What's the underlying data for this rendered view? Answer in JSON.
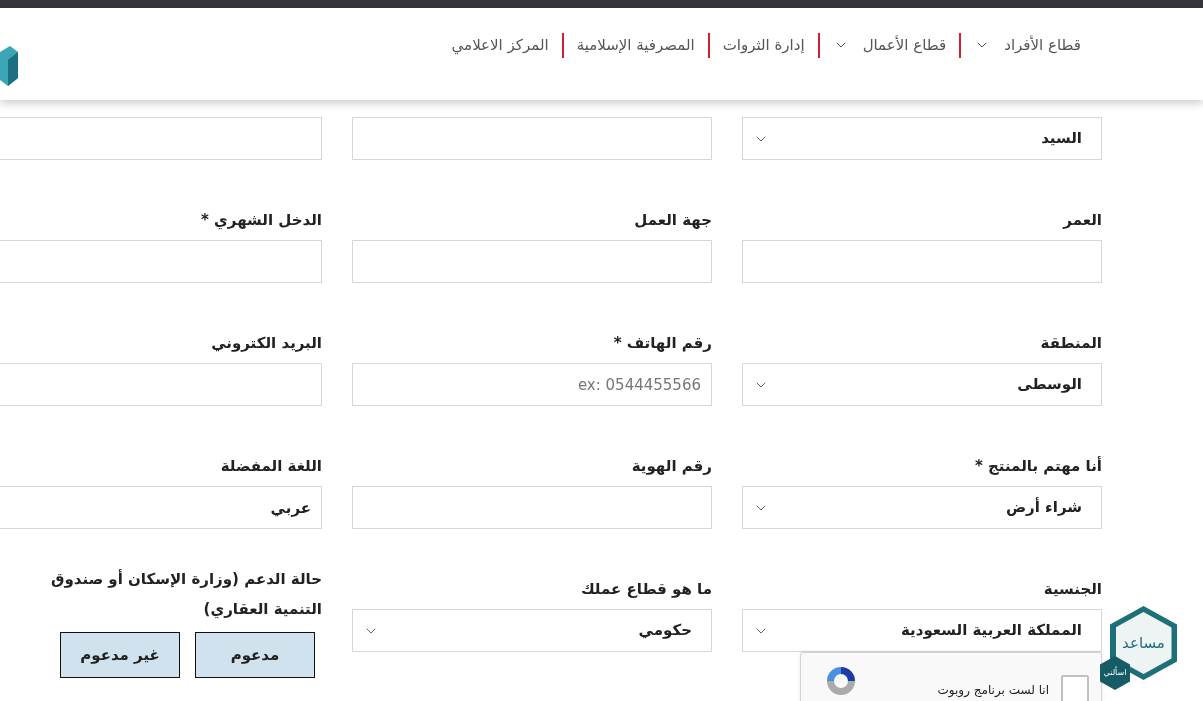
{
  "header": {
    "nav": [
      {
        "label": "قطاع الأفراد",
        "has_dropdown": true
      },
      {
        "label": "قطاع الأعمال",
        "has_dropdown": true
      },
      {
        "label": "إدارة الثروات",
        "has_dropdown": false
      },
      {
        "label": "المصرفية الإسلامية",
        "has_dropdown": false
      },
      {
        "label": "المركز الاعلامي",
        "has_dropdown": false
      }
    ]
  },
  "form": {
    "rows": [
      [
        {
          "kind": "select",
          "value": "السيد"
        },
        {
          "kind": "input"
        },
        {
          "kind": "input"
        }
      ],
      [
        {
          "kind": "input",
          "label": "العمر"
        },
        {
          "kind": "input",
          "label": "جهة العمل"
        },
        {
          "kind": "input",
          "label": "الدخل الشهري *"
        }
      ],
      [
        {
          "kind": "select",
          "label": "المنطقة",
          "value": "الوسطى"
        },
        {
          "kind": "input",
          "label": "رقم الهاتف *",
          "placeholder": "ex: 0544455566"
        },
        {
          "kind": "input",
          "label": "البريد الكتروني"
        }
      ],
      [
        {
          "kind": "select",
          "label": "أنا مهتم بالمنتج *",
          "value": "شراء أرض"
        },
        {
          "kind": "input",
          "label": "رقم الهوية"
        },
        {
          "kind": "input",
          "label": "اللغة المفضلة",
          "value": "عربي"
        }
      ],
      [
        {
          "kind": "select",
          "label": "الجنسية",
          "value": "المملكة العربية السعودية"
        },
        {
          "kind": "select",
          "label": "ما هو قطاع عملك",
          "value": "حكومي"
        },
        {
          "kind": "choice",
          "label": "حالة الدعم (وزارة الإسكان أو صندوق التنمية العقاري)",
          "options": [
            {
              "label": "مدعوم",
              "selected": false
            },
            {
              "label": "غير مدعوم",
              "selected": false
            }
          ]
        }
      ]
    ]
  },
  "captcha": {
    "label": "انا لست برنامج روبوت",
    "checked": false
  },
  "assistant": {
    "title": "مساعد",
    "badge": "اسألني"
  }
}
